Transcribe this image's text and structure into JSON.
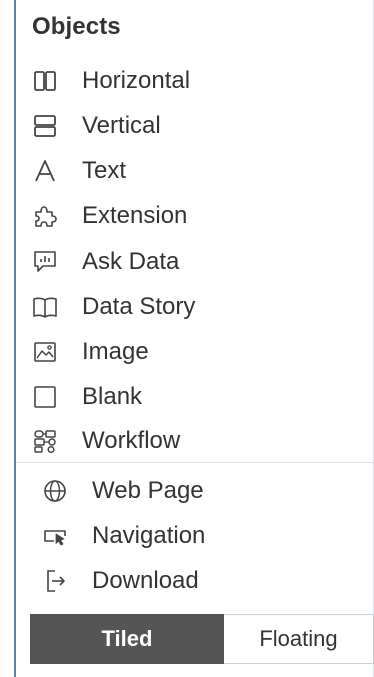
{
  "panel": {
    "title": "Objects",
    "items": [
      {
        "label": "Horizontal",
        "icon": "horizontal-layout-icon"
      },
      {
        "label": "Vertical",
        "icon": "vertical-layout-icon"
      },
      {
        "label": "Text",
        "icon": "text-icon"
      },
      {
        "label": "Extension",
        "icon": "extension-puzzle-icon"
      },
      {
        "label": "Ask Data",
        "icon": "ask-data-chat-icon"
      },
      {
        "label": "Data Story",
        "icon": "data-story-book-icon"
      },
      {
        "label": "Image",
        "icon": "image-icon"
      },
      {
        "label": "Blank",
        "icon": "blank-square-icon"
      },
      {
        "label": "Workflow",
        "icon": "workflow-icon"
      }
    ],
    "more_items": [
      {
        "label": "Web Page",
        "icon": "globe-icon"
      },
      {
        "label": "Navigation",
        "icon": "navigation-cursor-icon"
      },
      {
        "label": "Download",
        "icon": "download-export-icon"
      }
    ]
  },
  "layout_toggle": {
    "tiled": "Tiled",
    "floating": "Floating",
    "selected": "Tiled"
  },
  "colors": {
    "panel_border": "#5b7fae",
    "active_toggle_bg": "#555555",
    "text": "#333333"
  }
}
